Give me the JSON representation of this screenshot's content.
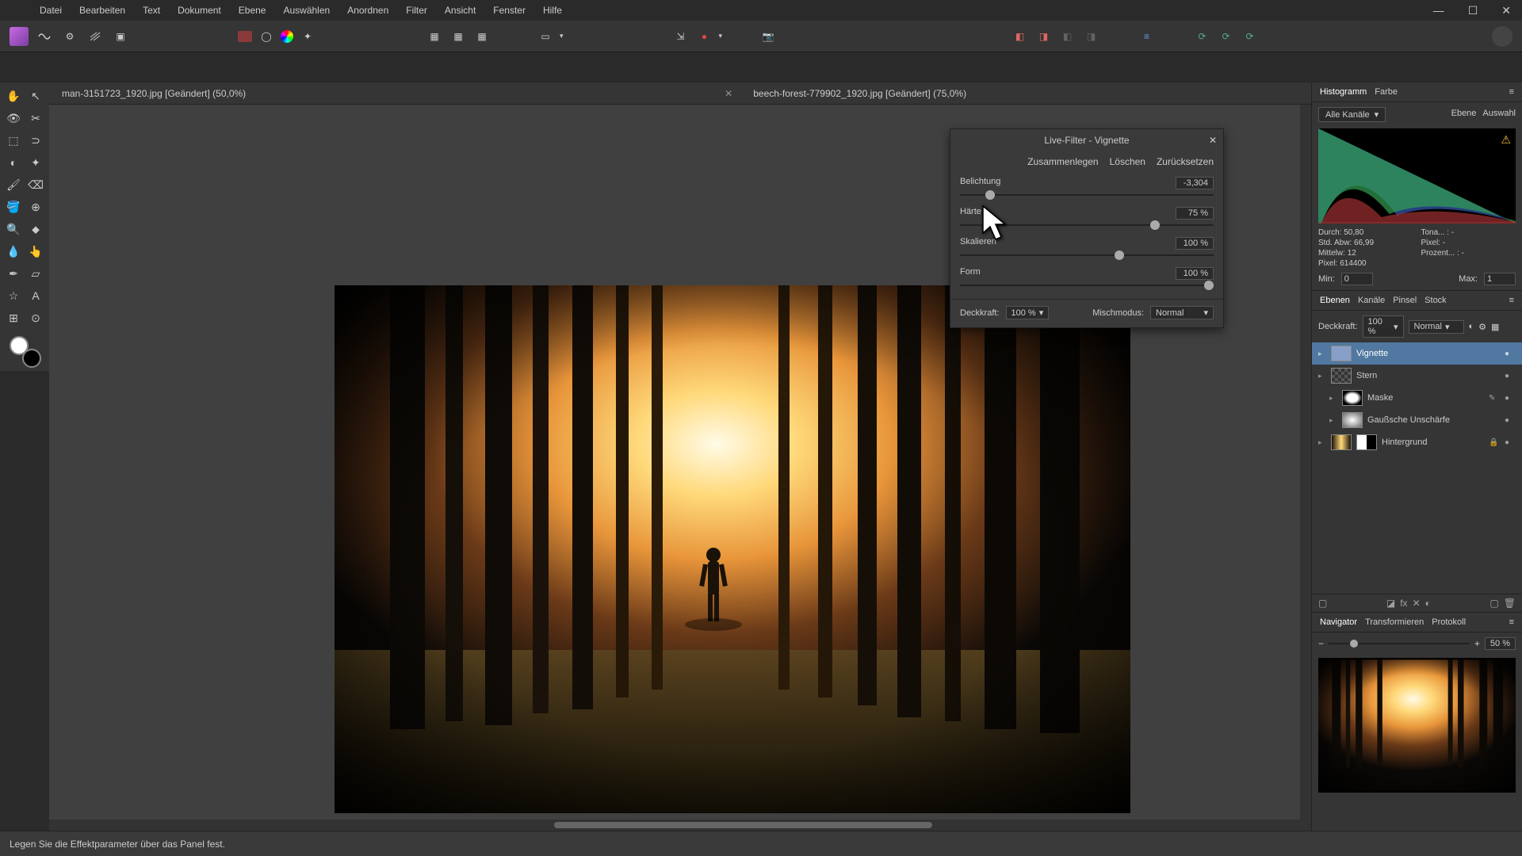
{
  "menus": [
    "Datei",
    "Bearbeiten",
    "Text",
    "Dokument",
    "Ebene",
    "Auswählen",
    "Anordnen",
    "Filter",
    "Ansicht",
    "Fenster",
    "Hilfe"
  ],
  "tabs": [
    {
      "name": "man-3151723_1920.jpg [Geändert] (50,0%)"
    },
    {
      "name": "beech-forest-779902_1920.jpg [Geändert] (75,0%)"
    }
  ],
  "dialog": {
    "title": "Live-Filter - Vignette",
    "actions": {
      "merge": "Zusammenlegen",
      "delete": "Löschen",
      "reset": "Zurücksetzen"
    },
    "sliders": {
      "belichtung": {
        "label": "Belichtung",
        "value": "-3,304",
        "pos": 10
      },
      "haerte": {
        "label": "Härte",
        "value": "75 %",
        "pos": 75
      },
      "skalieren": {
        "label": "Skalieren",
        "value": "100 %",
        "pos": 61
      },
      "form": {
        "label": "Form",
        "value": "100 %",
        "pos": 100
      }
    },
    "footer": {
      "deckkraft_label": "Deckkraft:",
      "deckkraft_value": "100 %",
      "misch_label": "Mischmodus:",
      "misch_value": "Normal"
    }
  },
  "histogram": {
    "tabs": [
      "Histogramm",
      "Farbe"
    ],
    "channel": "Alle Kanäle",
    "right_tabs": [
      "Ebene",
      "Auswahl"
    ],
    "stats": {
      "durch_label": "Durch:",
      "durch": "50,80",
      "stdabw_label": "Std. Abw:",
      "stdabw": "66,99",
      "mittelw_label": "Mittelw:",
      "mittelw": "12",
      "pixel_label": "Pixel:",
      "pixel": "614400",
      "tona_label": "Tona... :",
      "tona": "-",
      "prozent_label": "Prozent... :",
      "prozent": "-",
      "pixel2_label": "Pixel:",
      "pixel2": "-"
    },
    "min_label": "Min:",
    "min_value": "0",
    "max_label": "Max:",
    "max_value": "1"
  },
  "layers": {
    "tabs": [
      "Ebenen",
      "Kanäle",
      "Pinsel",
      "Stock"
    ],
    "header": {
      "deckkraft_label": "Deckkraft:",
      "deckkraft_value": "100 %",
      "mode": "Normal"
    },
    "list": [
      {
        "name": "Vignette",
        "active": true,
        "indent": 0
      },
      {
        "name": "Stern",
        "active": false,
        "indent": 0
      },
      {
        "name": "Maske",
        "active": false,
        "indent": 1
      },
      {
        "name": "Gaußsche Unschärfe",
        "active": false,
        "indent": 1
      },
      {
        "name": "Hintergrund",
        "active": false,
        "indent": 0,
        "locked": true,
        "double_thumb": true
      }
    ]
  },
  "navigator": {
    "tabs": [
      "Navigator",
      "Transformieren",
      "Protokoll"
    ],
    "zoom": "50 %"
  },
  "statusbar": "Legen Sie die Effektparameter über das Panel fest."
}
